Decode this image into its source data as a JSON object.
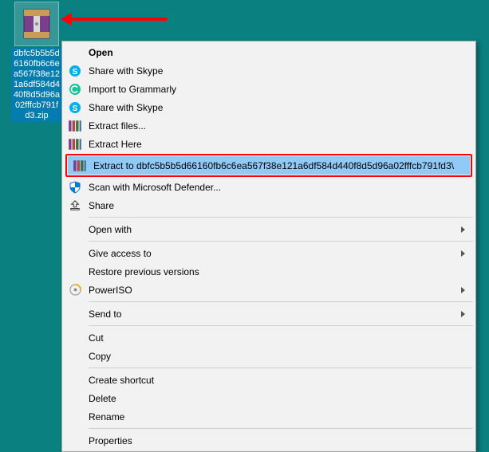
{
  "file": {
    "name": "dbfc5b5b5d6160fb6c6ea567f38e121a6df584d440f8d5d96a02fffcb791fd3.zip"
  },
  "menu": {
    "open": "Open",
    "share_skype_1": "Share with Skype",
    "import_grammarly": "Import to Grammarly",
    "share_skype_2": "Share with Skype",
    "extract_files": "Extract files...",
    "extract_here": "Extract Here",
    "extract_to": "Extract to dbfc5b5b5d66160fb6c6ea567f38e121a6df584d440f8d5d96a02fffcb791fd3\\",
    "scan_defender": "Scan with Microsoft Defender...",
    "share": "Share",
    "open_with": "Open with",
    "give_access": "Give access to",
    "restore_versions": "Restore previous versions",
    "poweriso": "PowerISO",
    "send_to": "Send to",
    "cut": "Cut",
    "copy": "Copy",
    "create_shortcut": "Create shortcut",
    "delete": "Delete",
    "rename": "Rename",
    "properties": "Properties"
  }
}
